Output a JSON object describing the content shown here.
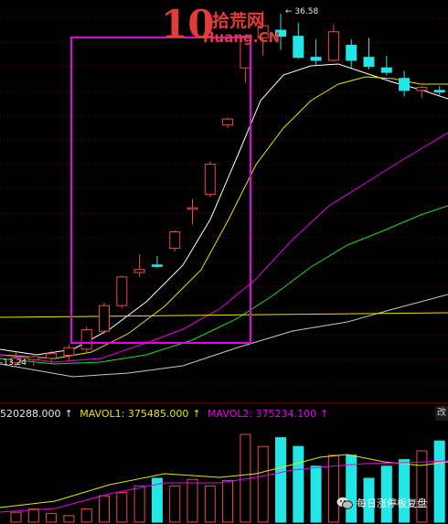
{
  "watermark": {
    "logo_big": "10",
    "logo_cn": "拾荒网",
    "logo_domain": "Huang.CN"
  },
  "price_labels": {
    "high": "36.58",
    "low": "13.24"
  },
  "volume_legend": {
    "vol": "520288.000",
    "mavol1": "MAVOL1: 375485.000",
    "mavol2": "MAVOL2: 375234.100",
    "arrow": "↑"
  },
  "wechat_watermark": "每日涨停板复盘",
  "side_tab": "改",
  "colors": {
    "up": "#e84a4a",
    "down": "#22e6e6",
    "ma5": "#ffffff",
    "ma10": "#e6e600",
    "ma20": "#e600e6",
    "ma30": "#22dd22",
    "ma60": "#c8c8c8",
    "hline": "#e6e600",
    "grid": "#7a0000",
    "highlight_box": "#e600e6"
  },
  "chart_data": {
    "type": "candlestick",
    "title": "",
    "price_high_marker": 36.58,
    "price_low_marker": 13.24,
    "candles": [
      {
        "o": 13.2,
        "h": 13.9,
        "l": 12.9,
        "c": 13.5
      },
      {
        "o": 13.4,
        "h": 13.8,
        "l": 13.0,
        "c": 13.6
      },
      {
        "o": 13.5,
        "h": 14.0,
        "l": 13.2,
        "c": 13.8
      },
      {
        "o": 13.7,
        "h": 14.4,
        "l": 13.3,
        "c": 14.2
      },
      {
        "o": 14.1,
        "h": 15.6,
        "l": 13.9,
        "c": 15.4
      },
      {
        "o": 15.3,
        "h": 17.2,
        "l": 15.1,
        "c": 17.0
      },
      {
        "o": 17.0,
        "h": 19.0,
        "l": 16.8,
        "c": 18.9
      },
      {
        "o": 19.2,
        "h": 20.4,
        "l": 18.9,
        "c": 19.4
      },
      {
        "o": 19.7,
        "h": 20.3,
        "l": 19.5,
        "c": 19.6
      },
      {
        "o": 20.8,
        "h": 22.0,
        "l": 20.6,
        "c": 21.9
      },
      {
        "o": 23.4,
        "h": 24.1,
        "l": 22.4,
        "c": 23.5
      },
      {
        "o": 24.4,
        "h": 26.6,
        "l": 24.2,
        "c": 26.4
      },
      {
        "o": 29.0,
        "h": 29.5,
        "l": 28.8,
        "c": 29.4
      },
      {
        "o": 32.8,
        "h": 35.0,
        "l": 31.8,
        "c": 34.9
      },
      {
        "o": 34.8,
        "h": 36.58,
        "l": 33.6,
        "c": 35.6
      },
      {
        "o": 35.3,
        "h": 36.4,
        "l": 34.0,
        "c": 34.9
      },
      {
        "o": 34.9,
        "h": 35.8,
        "l": 33.4,
        "c": 33.5
      },
      {
        "o": 33.5,
        "h": 34.7,
        "l": 32.9,
        "c": 33.3
      },
      {
        "o": 33.3,
        "h": 35.7,
        "l": 33.2,
        "c": 35.2
      },
      {
        "o": 34.3,
        "h": 34.7,
        "l": 32.8,
        "c": 33.3
      },
      {
        "o": 33.5,
        "h": 34.8,
        "l": 32.7,
        "c": 32.9
      },
      {
        "o": 32.8,
        "h": 33.6,
        "l": 32.3,
        "c": 32.5
      },
      {
        "o": 32.1,
        "h": 32.6,
        "l": 30.9,
        "c": 31.3
      },
      {
        "o": 31.3,
        "h": 31.6,
        "l": 30.8,
        "c": 31.5
      },
      {
        "o": 31.3,
        "h": 31.6,
        "l": 31.0,
        "c": 31.2
      },
      {
        "o": 31.4,
        "h": 34.4,
        "l": 31.2,
        "c": 34.1
      }
    ],
    "volume": [
      9,
      12,
      8,
      6,
      12,
      24,
      27,
      33,
      40,
      33,
      39,
      33,
      38,
      80,
      69,
      77,
      69,
      51,
      61,
      61,
      40,
      51,
      57,
      65,
      74,
      96
    ]
  }
}
